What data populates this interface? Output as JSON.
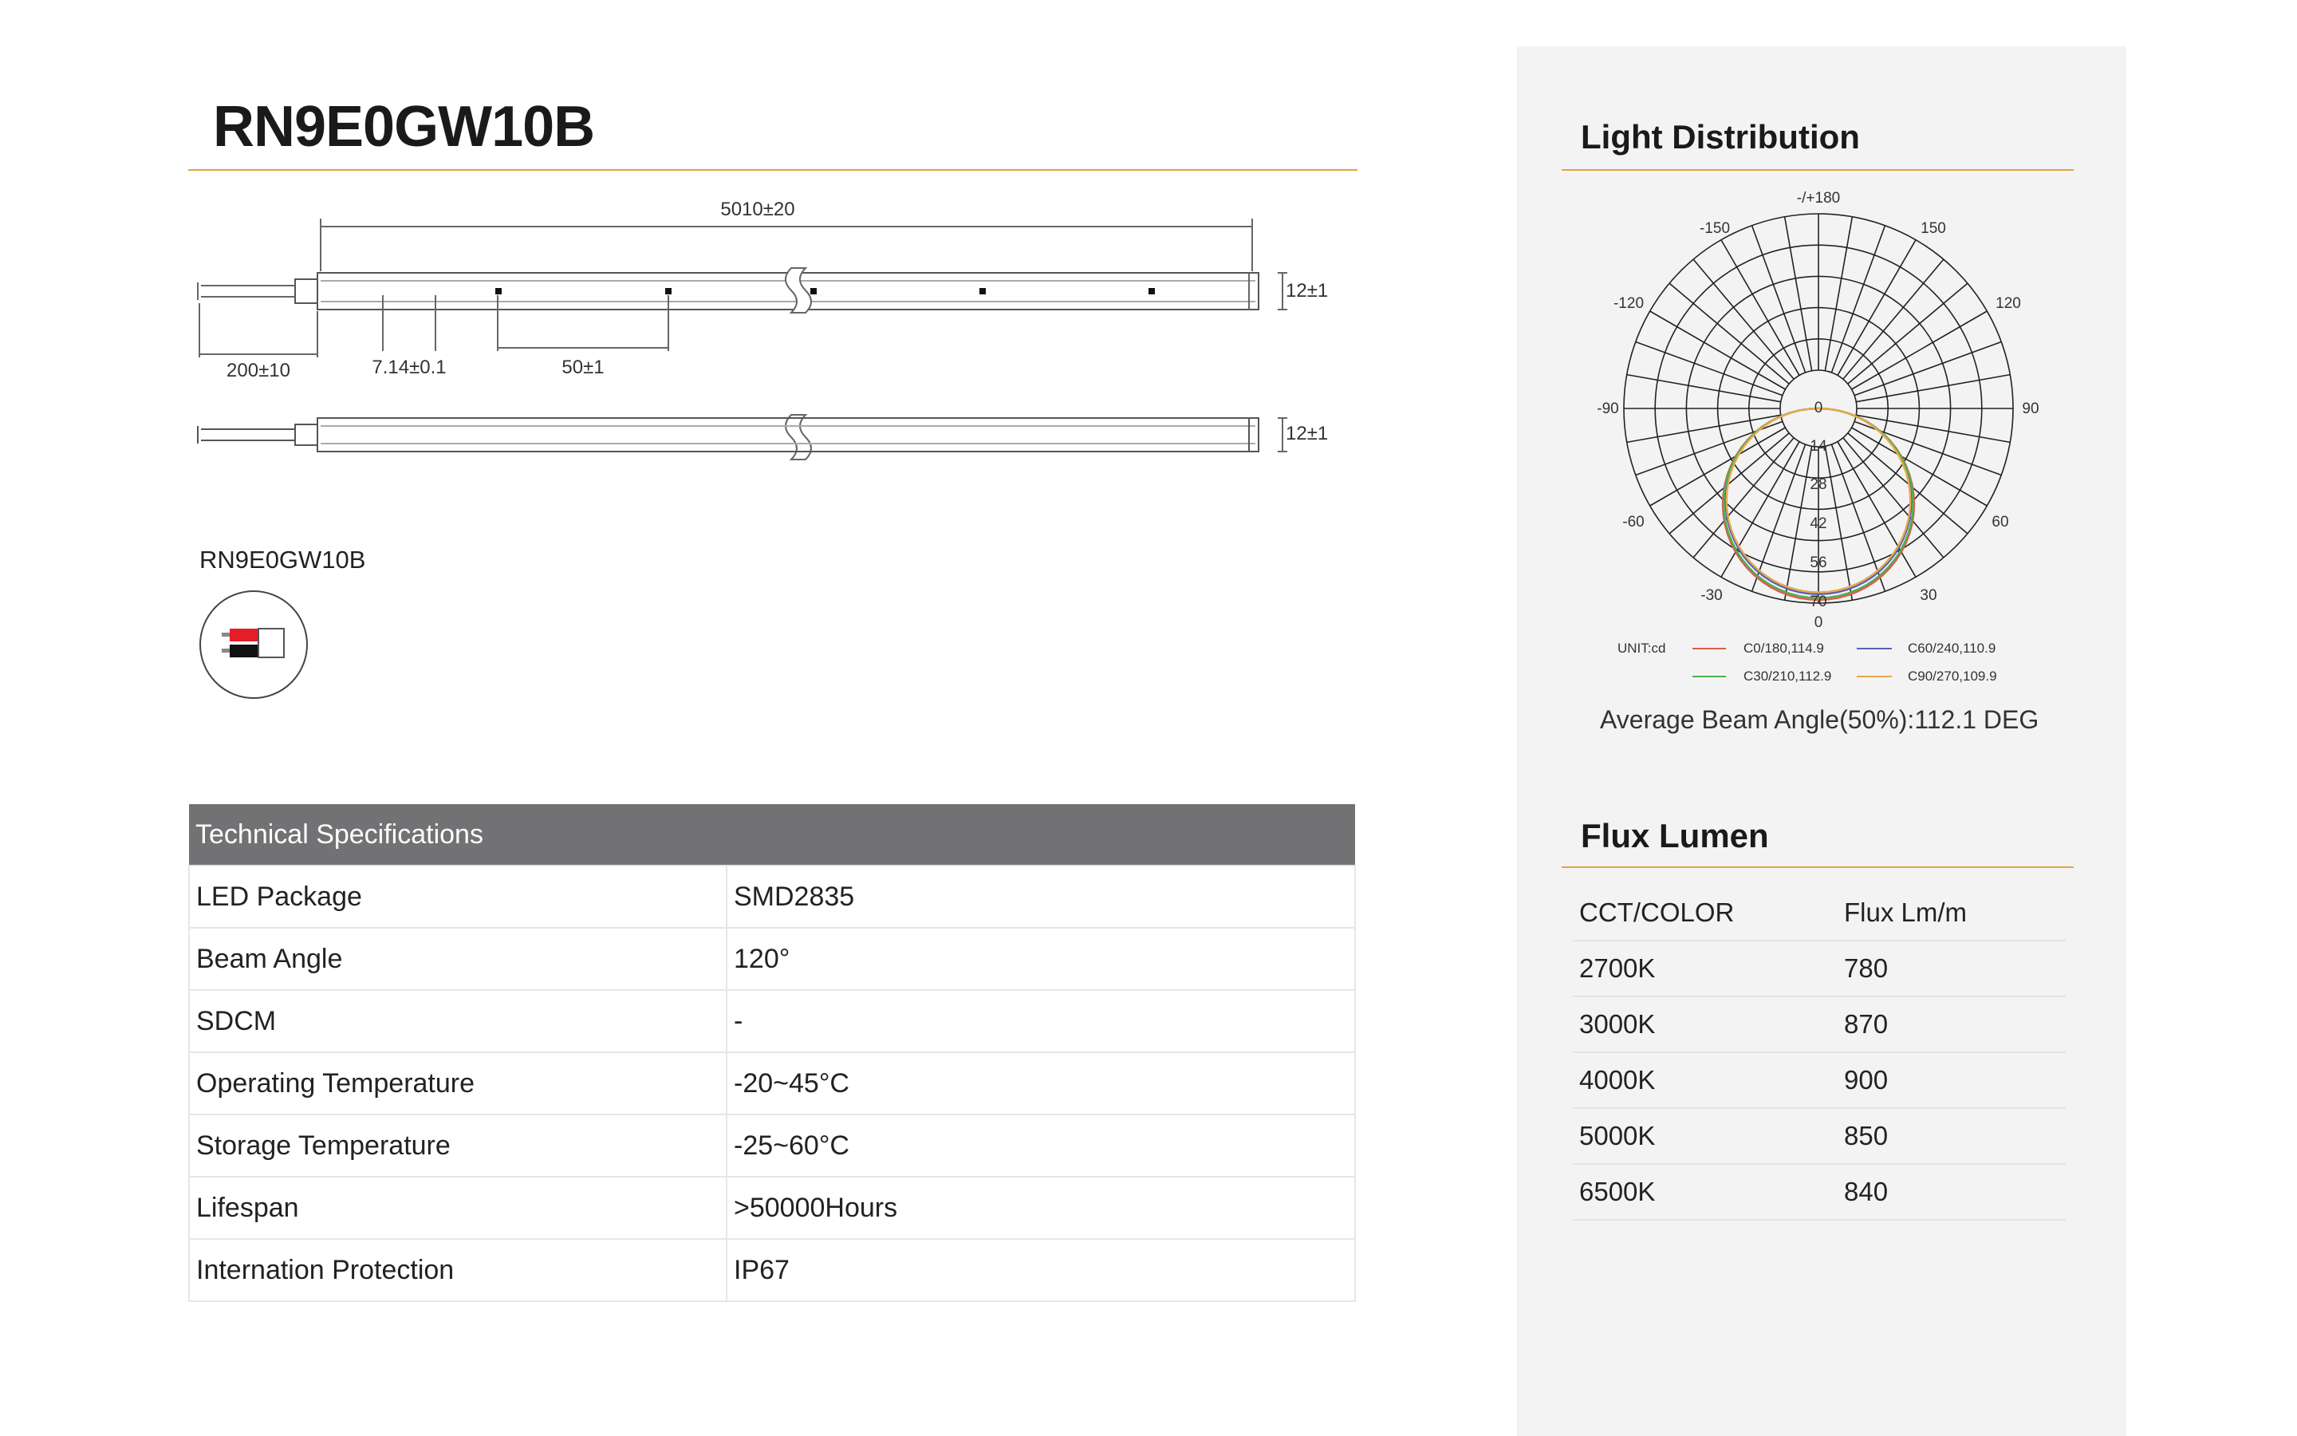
{
  "product": {
    "model": "RN9E0GW10B"
  },
  "drawing": {
    "length_dim": "5010±20",
    "height_dim_top": "12±1",
    "height_dim_bottom": "12±1",
    "lead_dim": "200±10",
    "pitch_dim": "7.14±0.1",
    "cut_dim": "50±1"
  },
  "wiring": {
    "label": "RN9E0GW10B"
  },
  "specs": {
    "header": "Technical Specifications",
    "rows": [
      {
        "name": "LED Package",
        "value": "SMD2835"
      },
      {
        "name": "Beam Angle",
        "value": "120°"
      },
      {
        "name": "SDCM",
        "value": "-"
      },
      {
        "name": "Operating Temperature",
        "value": "-20~45°C"
      },
      {
        "name": "Storage Temperature",
        "value": "-25~60°C"
      },
      {
        "name": "Lifespan",
        "value": ">50000Hours"
      },
      {
        "name": "Internation Protection",
        "value": "IP67"
      }
    ]
  },
  "light_distribution": {
    "title": "Light Distribution",
    "unit_label": "UNIT:cd",
    "angle_labels": {
      "top": "-/+180",
      "tl150": "-150",
      "tr150": "150",
      "l120": "-120",
      "r120": "120",
      "l90": "-90",
      "r90": "90",
      "l60": "-60",
      "r60": "60",
      "l30": "-30",
      "r30": "30",
      "bottom": "0"
    },
    "radial_labels": [
      "0",
      "14",
      "28",
      "42",
      "56",
      "70"
    ],
    "legend": [
      {
        "name": "C0/180,114.9",
        "color": "#e05a4a"
      },
      {
        "name": "C60/240,110.9",
        "color": "#5b5fb8"
      },
      {
        "name": "C30/210,112.9",
        "color": "#4caf50"
      },
      {
        "name": "C90/270,109.9",
        "color": "#e8a94a"
      }
    ],
    "beam_text": "Average Beam Angle(50%):112.1 DEG"
  },
  "flux": {
    "title": "Flux Lumen",
    "header": {
      "col1": "CCT/COLOR",
      "col2": "Flux Lm/m"
    },
    "rows": [
      {
        "cct": "2700K",
        "flux": "780"
      },
      {
        "cct": "3000K",
        "flux": "870"
      },
      {
        "cct": "4000K",
        "flux": "900"
      },
      {
        "cct": "5000K",
        "flux": "850"
      },
      {
        "cct": "6500K",
        "flux": "840"
      }
    ]
  }
}
